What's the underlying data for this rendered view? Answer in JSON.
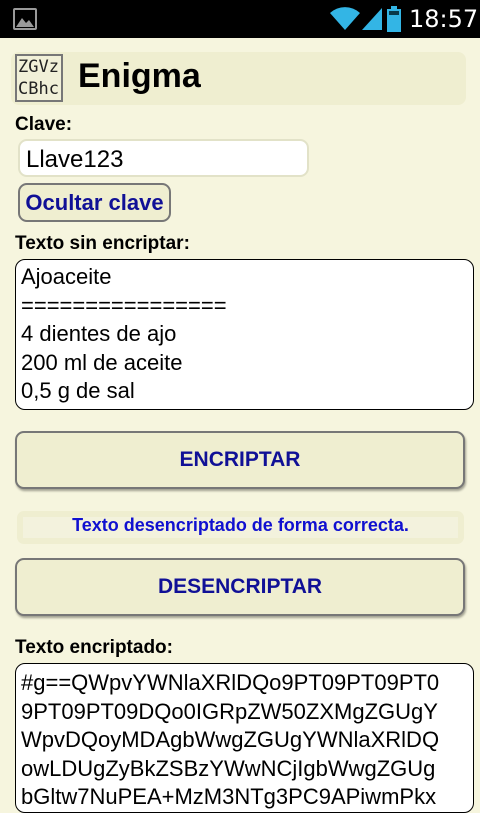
{
  "status_bar": {
    "time": "18:57",
    "icons": [
      "gallery-icon",
      "wifi-icon",
      "signal-icon",
      "battery-icon"
    ]
  },
  "header": {
    "logo_lines": [
      "ZGVz",
      "CBhc"
    ],
    "title": "Enigma"
  },
  "key": {
    "label": "Clave:",
    "value": "Llave123"
  },
  "hide_key_button": "Ocultar clave",
  "plain_text": {
    "label": "Texto sin encriptar:",
    "lines": [
      "Ajoaceite",
      "================",
      "4 dientes de ajo",
      "200 ml de aceite",
      "0,5 g de sal"
    ]
  },
  "encrypt_button": "ENCRIPTAR",
  "status_message": "Texto desencriptado de forma correcta.",
  "decrypt_button": "DESENCRIPTAR",
  "encrypted_text": {
    "label": "Texto encriptado:",
    "lines": [
      "#g==QWpvYWNlaXRlDQo9PT09PT09PT0",
      "9PT09PT09DQo0IGRpZW50ZXMgZGUgY",
      "WpvDQoyMDAgbWwgZGUgYWNlaXRlDQ",
      "owLDUgZyBkZSBzYWwNCjIgbWwgZGUg",
      "bGltw7NuPEA+MzM3NTg3PC9APiwmPkx"
    ]
  },
  "colors": {
    "background": "#f6f5de",
    "panel": "#efeed0",
    "button_text": "#101096",
    "status_text": "#1010d0"
  }
}
